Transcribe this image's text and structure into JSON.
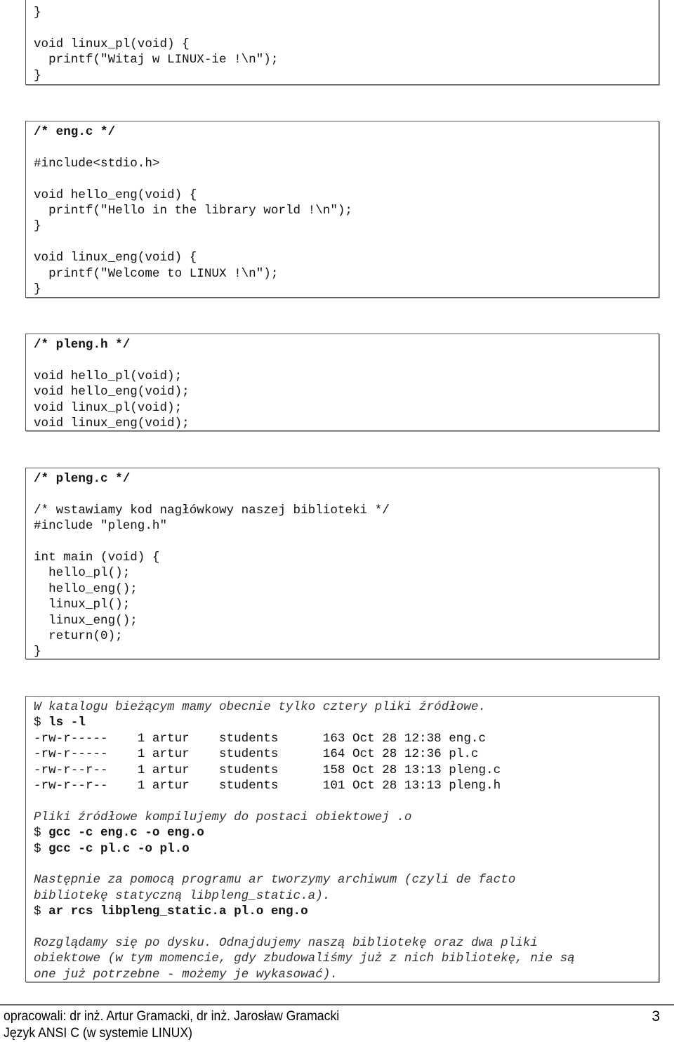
{
  "code_boxes": [
    {
      "lines": [
        [
          {
            "t": "}",
            "s": ""
          }
        ],
        [],
        [
          {
            "t": "void linux_pl(void) {",
            "s": ""
          }
        ],
        [
          {
            "t": "  printf(\"Witaj w LINUX-ie !\\n\");",
            "s": ""
          }
        ],
        [
          {
            "t": "}",
            "s": ""
          }
        ]
      ]
    },
    {
      "lines": [
        [
          {
            "t": "/* eng.c */",
            "s": "b"
          }
        ],
        [],
        [
          {
            "t": "#include<stdio.h>",
            "s": ""
          }
        ],
        [],
        [
          {
            "t": "void hello_eng(void) {",
            "s": ""
          }
        ],
        [
          {
            "t": "  printf(\"Hello in the library world !\\n\");",
            "s": ""
          }
        ],
        [
          {
            "t": "}",
            "s": ""
          }
        ],
        [],
        [
          {
            "t": "void linux_eng(void) {",
            "s": ""
          }
        ],
        [
          {
            "t": "  printf(\"Welcome to LINUX !\\n\");",
            "s": ""
          }
        ],
        [
          {
            "t": "}",
            "s": ""
          }
        ]
      ]
    },
    {
      "lines": [
        [
          {
            "t": "/* pleng.h */",
            "s": "b"
          }
        ],
        [],
        [
          {
            "t": "void hello_pl(void);",
            "s": ""
          }
        ],
        [
          {
            "t": "void hello_eng(void);",
            "s": ""
          }
        ],
        [
          {
            "t": "void linux_pl(void);",
            "s": ""
          }
        ],
        [
          {
            "t": "void linux_eng(void);",
            "s": ""
          }
        ]
      ]
    },
    {
      "lines": [
        [
          {
            "t": "/* pleng.c */",
            "s": "b"
          }
        ],
        [],
        [
          {
            "t": "/* wstawiamy kod nagłówkowy naszej biblioteki */",
            "s": ""
          }
        ],
        [
          {
            "t": "#include \"pleng.h\"",
            "s": ""
          }
        ],
        [],
        [
          {
            "t": "int main (void) {",
            "s": ""
          }
        ],
        [
          {
            "t": "  hello_pl();",
            "s": ""
          }
        ],
        [
          {
            "t": "  hello_eng();",
            "s": ""
          }
        ],
        [
          {
            "t": "  linux_pl();",
            "s": ""
          }
        ],
        [
          {
            "t": "  linux_eng();",
            "s": ""
          }
        ],
        [
          {
            "t": "  return(0);",
            "s": ""
          }
        ],
        [
          {
            "t": "}",
            "s": ""
          }
        ]
      ]
    },
    {
      "lines": [
        [
          {
            "t": "W katalogu bieżącym mamy obecnie tylko cztery pliki źródłowe.",
            "s": "i"
          }
        ],
        [
          {
            "t": "$ ",
            "s": ""
          },
          {
            "t": "ls -l",
            "s": "b"
          }
        ],
        [
          {
            "t": "-rw-r-----    1 artur    students      163 Oct 28 12:38 eng.c",
            "s": ""
          }
        ],
        [
          {
            "t": "-rw-r-----    1 artur    students      164 Oct 28 12:36 pl.c",
            "s": ""
          }
        ],
        [
          {
            "t": "-rw-r--r--    1 artur    students      158 Oct 28 13:13 pleng.c",
            "s": ""
          }
        ],
        [
          {
            "t": "-rw-r--r--    1 artur    students      101 Oct 28 13:13 pleng.h",
            "s": ""
          }
        ],
        [],
        [
          {
            "t": "Pliki źródłowe kompilujemy do postaci obiektowej .o",
            "s": "i"
          }
        ],
        [
          {
            "t": "$ ",
            "s": ""
          },
          {
            "t": "gcc -c eng.c -o eng.o",
            "s": "b"
          }
        ],
        [
          {
            "t": "$ ",
            "s": ""
          },
          {
            "t": "gcc -c pl.c -o pl.o",
            "s": "b"
          }
        ],
        [],
        [
          {
            "t": "Następnie za pomocą programu ar tworzymy archiwum (czyli de facto",
            "s": "i"
          }
        ],
        [
          {
            "t": "bibliotekę statyczną libpleng_static.a).",
            "s": "i"
          }
        ],
        [
          {
            "t": "$ ",
            "s": ""
          },
          {
            "t": "ar rcs libpleng_static.a pl.o eng.o",
            "s": "b"
          }
        ],
        [],
        [
          {
            "t": "Rozglądamy się po dysku. Odnajdujemy naszą bibliotekę oraz dwa pliki",
            "s": "i"
          }
        ],
        [
          {
            "t": "obiektowe (w tym momencie, gdy zbudowaliśmy już z nich bibliotekę, nie są",
            "s": "i"
          }
        ],
        [
          {
            "t": "one już potrzebne - możemy je wykasować).",
            "s": "i"
          }
        ]
      ]
    }
  ],
  "footer": {
    "authors": "opracowali: dr inż. Artur Gramacki, dr inż. Jarosław Gramacki",
    "subtitle": "Język ANSI C (w systemie LINUX)",
    "page_number": "3"
  }
}
